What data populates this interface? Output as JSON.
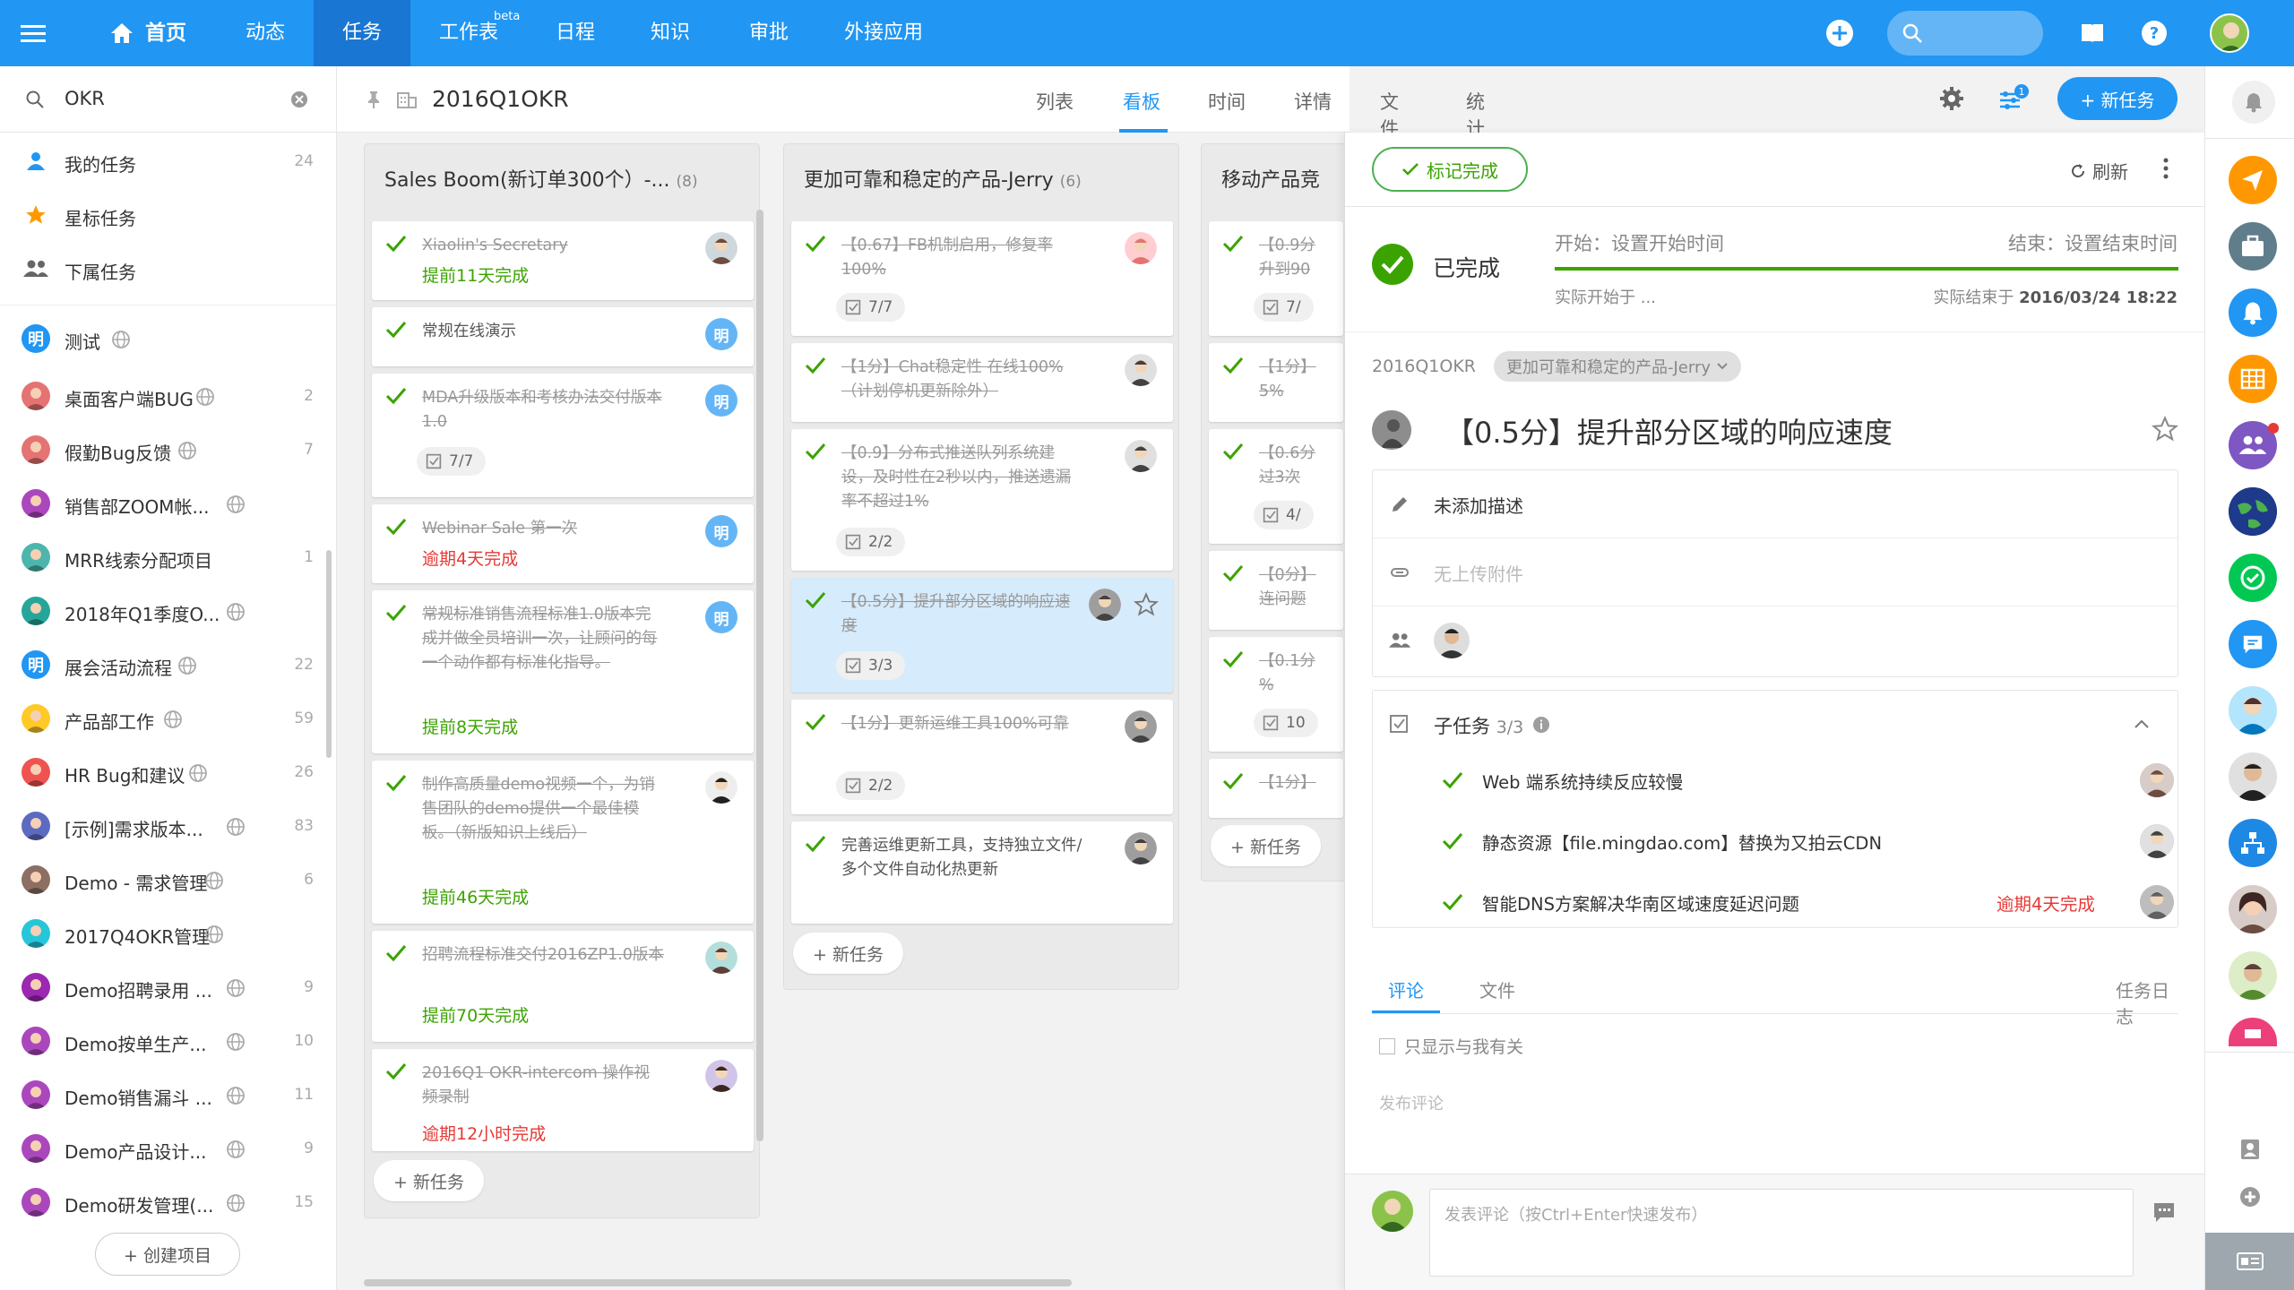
{
  "nav": {
    "home": "首页",
    "items": [
      "动态",
      "任务",
      "工作表",
      "日程",
      "知识",
      "审批",
      "外接应用"
    ],
    "beta": "beta"
  },
  "sidebar": {
    "search_value": "OKR",
    "fixed": [
      {
        "label": "我的任务",
        "count": "24"
      },
      {
        "label": "星标任务",
        "count": ""
      },
      {
        "label": "下属任务",
        "count": ""
      }
    ],
    "projects": [
      {
        "label": "测试",
        "count": ""
      },
      {
        "label": "桌面客户端BUG",
        "count": "2"
      },
      {
        "label": "假勤Bug反馈",
        "count": "7"
      },
      {
        "label": "销售部ZOOM帐...",
        "count": ""
      },
      {
        "label": "MRR线索分配项目",
        "count": "1"
      },
      {
        "label": "2018年Q1季度O...",
        "count": ""
      },
      {
        "label": "展会活动流程",
        "count": "22"
      },
      {
        "label": "产品部工作",
        "count": "59"
      },
      {
        "label": "HR Bug和建议",
        "count": "26"
      },
      {
        "label": "[示例]需求版本...",
        "count": "83"
      },
      {
        "label": "Demo - 需求管理",
        "count": "6"
      },
      {
        "label": "2017Q4OKR管理",
        "count": ""
      },
      {
        "label": "Demo招聘录用 ...",
        "count": "9"
      },
      {
        "label": "Demo按单生产...",
        "count": "10"
      },
      {
        "label": "Demo销售漏斗 ...",
        "count": "11"
      },
      {
        "label": "Demo产品设计...",
        "count": "9"
      },
      {
        "label": "Demo研发管理(...",
        "count": "15"
      }
    ],
    "create_label": "+ 创建项目",
    "ming": "明"
  },
  "project": {
    "title": "2016Q1OKR",
    "tabs": [
      "列表",
      "看板",
      "时间",
      "详情",
      "文件",
      "统计"
    ],
    "new_task": "+ 新任务",
    "filter_badge": "1"
  },
  "board": {
    "columns": [
      {
        "title": "Sales Boom(新订单300个）-...",
        "count": "(8)",
        "cards": [
          {
            "text": "Xiaolin's Secretary",
            "status": "提前11天完成",
            "status_type": "ok"
          },
          {
            "text": "常规在线演示",
            "status": "",
            "status_type": ""
          },
          {
            "text": "MDA升级版本和考核办法交付版本1.0",
            "sub": "7/7"
          },
          {
            "text": "Webinar Sale 第一次",
            "status": "逾期4天完成",
            "status_type": "late"
          },
          {
            "text": "常规标准销售流程标准1.0版本完成并做全员培训一次，让顾问的每一个动作都有标准化指导。",
            "status": "提前8天完成",
            "status_type": "ok"
          },
          {
            "text": "制作高质量demo视频一个，为销售团队的demo提供一个最佳模板。（新版知识上线后）",
            "status": "提前46天完成",
            "status_type": "ok"
          },
          {
            "text": "招聘流程标准交付2016ZP1.0版本",
            "status": "提前70天完成",
            "status_type": "ok"
          },
          {
            "text": "2016Q1 OKR-intercom 操作视频录制",
            "status": "逾期12小时完成",
            "status_type": "late"
          }
        ],
        "add": "+ 新任务"
      },
      {
        "title": "更加可靠和稳定的产品-Jerry",
        "count": "(6)",
        "cards": [
          {
            "text": "【0.67】FB机制启用，修复率100%",
            "sub": "7/7"
          },
          {
            "text": "【1分】Chat稳定性 在线100%（计划停机更新除外）"
          },
          {
            "text": "【0.9】分布式推送队列系统建设，及时性在2秒以内，推送遗漏率不超过1%",
            "sub": "2/2"
          },
          {
            "text": "【0.5分】提升部分区域的响应速度",
            "sub": "3/3"
          },
          {
            "text": "【1分】更新运维工具100%可靠",
            "sub": "2/2"
          },
          {
            "text": "完善运维更新工具，支持独立文件/多个文件自动化热更新"
          }
        ],
        "add": "+ 新任务"
      },
      {
        "title": "移动产品竞",
        "cards": [
          {
            "text": "【0.9分",
            "text2": "升到90",
            "sub": "7/"
          },
          {
            "text": "【1分】",
            "text2": "5%"
          },
          {
            "text": "【0.6分",
            "text2": "过3次",
            "sub": "4/"
          },
          {
            "text": "【0分】",
            "text2": "连问题"
          },
          {
            "text": "【0.1分",
            "text2": "%",
            "sub": "10"
          },
          {
            "text": "【1分】"
          }
        ],
        "add": "+ 新任务"
      }
    ]
  },
  "detail": {
    "mark_done": "标记完成",
    "refresh": "刷新",
    "status": "已完成",
    "start_label": "开始：设置开始时间",
    "end_label": "结束：设置结束时间",
    "actual_start": "实际开始于 ...",
    "actual_end_prefix": "实际结束于",
    "actual_end_value": "2016/03/24 18:22",
    "project": "2016Q1OKR",
    "stage": "更加可靠和稳定的产品-Jerry",
    "title": "【0.5分】提升部分区域的响应速度",
    "description": "未添加描述",
    "attachments": "无上传附件",
    "subtasks_label": "子任务",
    "subtasks_count": "3/3",
    "subtasks": [
      {
        "text": "Web 端系统持续反应较慢",
        "late": ""
      },
      {
        "text": "静态资源【file.mingdao.com】替换为又拍云CDN",
        "late": ""
      },
      {
        "text": "智能DNS方案解决华南区域速度延迟问题",
        "late": "逾期4天完成"
      }
    ],
    "tab_comments": "评论",
    "tab_files": "文件",
    "tab_log": "任务日志",
    "only_mine": "只显示与我有关",
    "post_comment": "发布评论",
    "comment_placeholder": "发表评论（按Ctrl+Enter快速发布）"
  },
  "colors": {
    "primary": "#2196f3",
    "done": "#3ba300",
    "late": "#e53935"
  }
}
